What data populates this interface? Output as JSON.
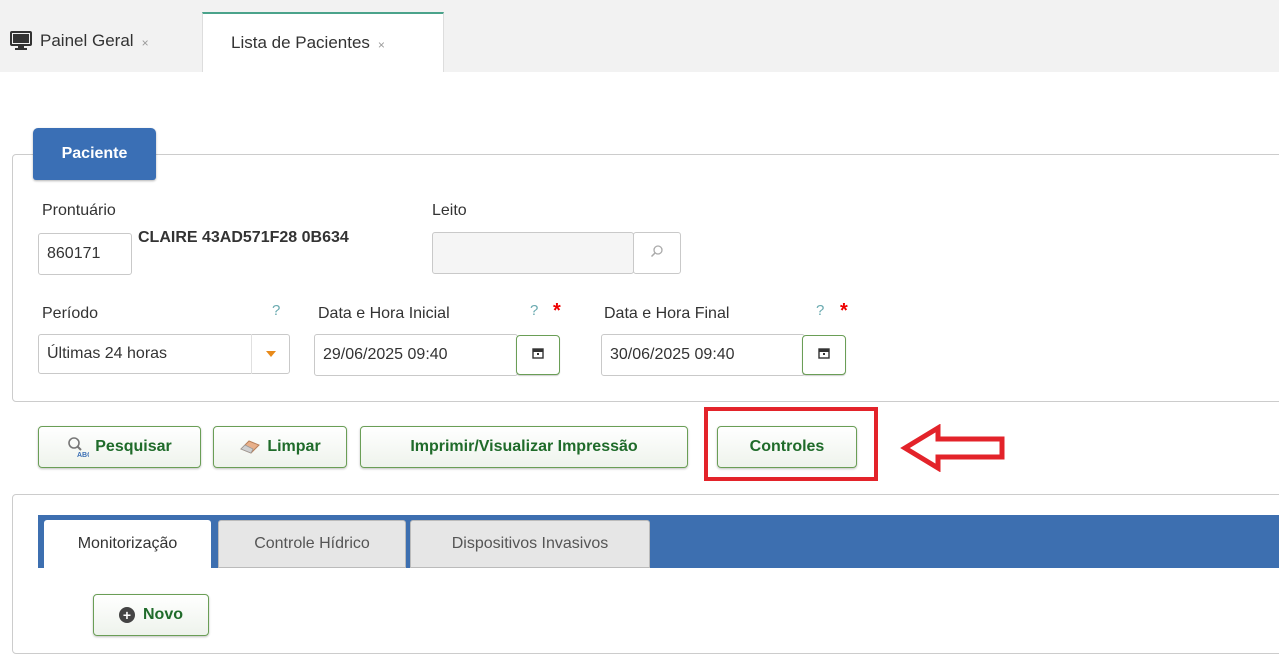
{
  "top_tabs": [
    {
      "label": "Painel Geral",
      "icon": "monitor-icon",
      "close": "×"
    },
    {
      "label": "Lista de Pacientes",
      "close": "×"
    }
  ],
  "patient": {
    "section_title": "Paciente",
    "prontuario_label": "Prontuário",
    "prontuario_value": "860171",
    "patient_name": "CLAIRE 43AD571F28 0B634",
    "leito_label": "Leito",
    "leito_value": "",
    "periodo_label": "Período",
    "periodo_value": "Últimas 24 horas",
    "data_inicial_label": "Data e Hora Inicial",
    "data_inicial_value": "29/06/2025 09:40",
    "data_final_label": "Data e Hora Final",
    "data_final_value": "30/06/2025 09:40",
    "help_mark": "?",
    "required_mark": "*"
  },
  "actions": {
    "pesquisar": "Pesquisar",
    "limpar": "Limpar",
    "imprimir": "Imprimir/Visualizar Impressão",
    "controles": "Controles"
  },
  "lower_tabs": [
    {
      "label": "Monitorização",
      "active": true
    },
    {
      "label": "Controle Hídrico",
      "active": false
    },
    {
      "label": "Dispositivos Invasivos",
      "active": false
    }
  ],
  "novo_label": "Novo",
  "colors": {
    "primary_blue": "#3a6fb5",
    "button_green": "#1f6b2a",
    "highlight_red": "#e3232a",
    "required_red": "#e00000",
    "help_teal": "#6aaab0"
  }
}
